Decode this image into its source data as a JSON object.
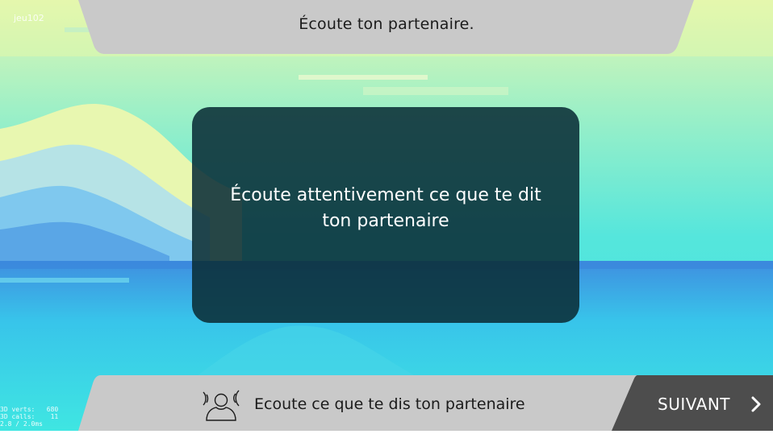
{
  "debug": {
    "label": "jeu102",
    "stats": "3D verts:   680\n3D calls:    11\n2.8 / 2.0ms"
  },
  "header": {
    "title": "Écoute ton partenaire."
  },
  "dialog": {
    "message": "Écoute attentivement ce que te dit ton partenaire"
  },
  "footer": {
    "instruction": "Ecoute ce que te dis ton partenaire",
    "instruction_icon": "listening-person-icon",
    "next_label": "SUIVANT",
    "next_icon": "chevron-right-icon"
  },
  "colors": {
    "banner": "#c9c9c9",
    "dialog": "#0a2d37",
    "next_button": "#4d4d4d",
    "sky_top": "#d9f5b0",
    "sea": "#3fe3e0"
  }
}
